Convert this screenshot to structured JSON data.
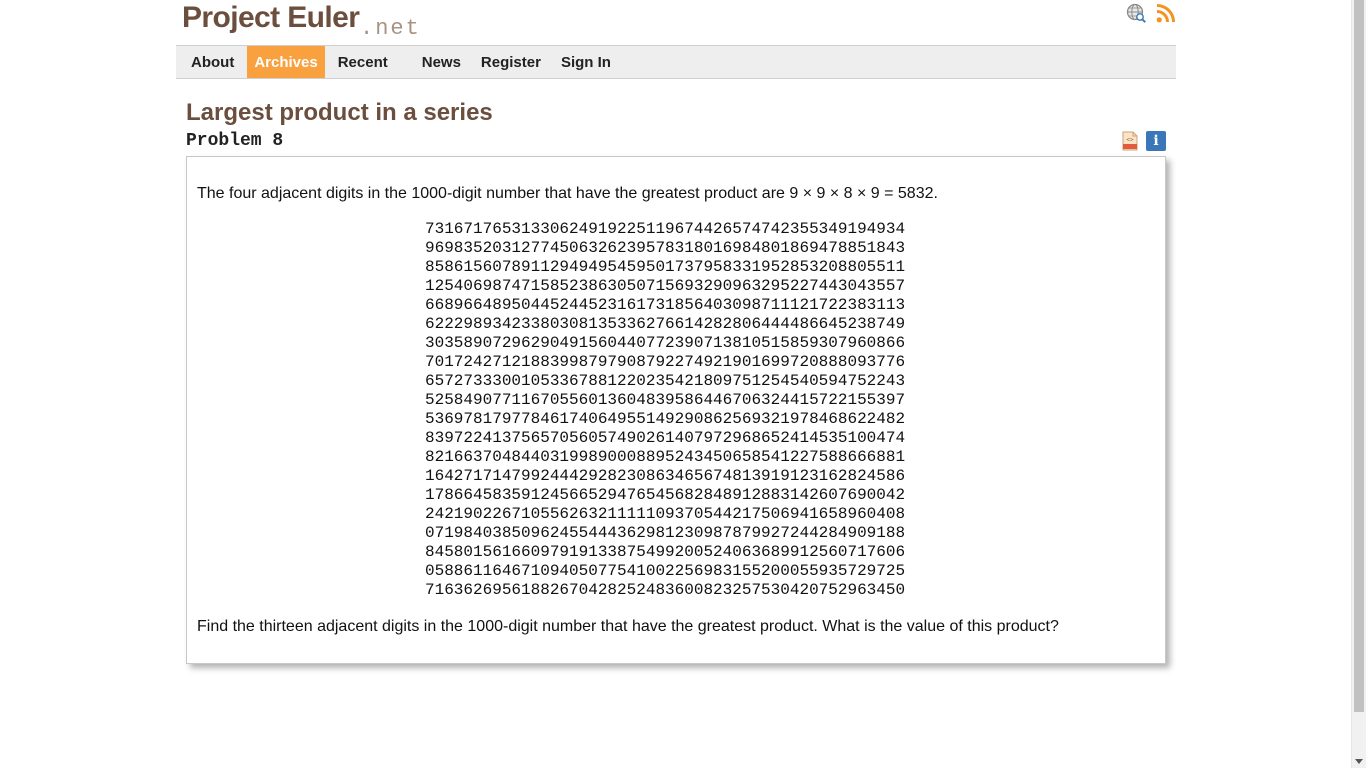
{
  "header": {
    "logo_main": "Project Euler",
    "logo_net": ".net",
    "icons": [
      "search-globe-icon",
      "rss-feed-icon"
    ]
  },
  "nav": {
    "items": [
      {
        "label": "About",
        "active": false
      },
      {
        "label": "Archives",
        "active": true
      },
      {
        "label": "Recent",
        "active": false
      },
      {
        "label": "News",
        "active": false
      },
      {
        "label": "Register",
        "active": false
      },
      {
        "label": "Sign In",
        "active": false
      }
    ]
  },
  "problem": {
    "title": "Largest product in a series",
    "number": "Problem 8",
    "intro": "The four adjacent digits in the 1000-digit number that have the greatest product are 9 × 9 × 8 × 9 = 5832.",
    "digits": [
      "73167176531330624919225119674426574742355349194934",
      "96983520312774506326239578318016984801869478851843",
      "85861560789112949495459501737958331952853208805511",
      "12540698747158523863050715693290963295227443043557",
      "66896648950445244523161731856403098711121722383113",
      "62229893423380308135336276614282806444486645238749",
      "30358907296290491560440772390713810515859307960866",
      "70172427121883998797908792274921901699720888093776",
      "65727333001053367881220235421809751254540594752243",
      "52584907711670556013604839586446706324415722155397",
      "53697817977846174064955149290862569321978468622482",
      "83972241375657056057490261407972968652414535100474",
      "82166370484403199890008895243450658541227588666881",
      "16427171479924442928230863465674813919123162824586",
      "17866458359124566529476545682848912883142607690042",
      "24219022671055626321111109370544217506941658960408",
      "07198403850962455444362981230987879927244284909188",
      "84580156166097919133875499200524063689912560717606",
      "05886116467109405077541002256983155200055935729725",
      "71636269561882670428252483600823257530420752963450"
    ],
    "question": "Find the thirteen adjacent digits in the 1000-digit number that have the greatest product. What is the value of this product?",
    "tool_icons": [
      "show-html-source-icon",
      "info-icon"
    ],
    "info_label": "i"
  },
  "colors": {
    "brand": "#6b4e3d",
    "brand_light": "#a89283",
    "nav_active": "#f9a03f",
    "nav_bg": "#eeeeee",
    "rss": "#f29322",
    "info": "#3a77b8"
  }
}
